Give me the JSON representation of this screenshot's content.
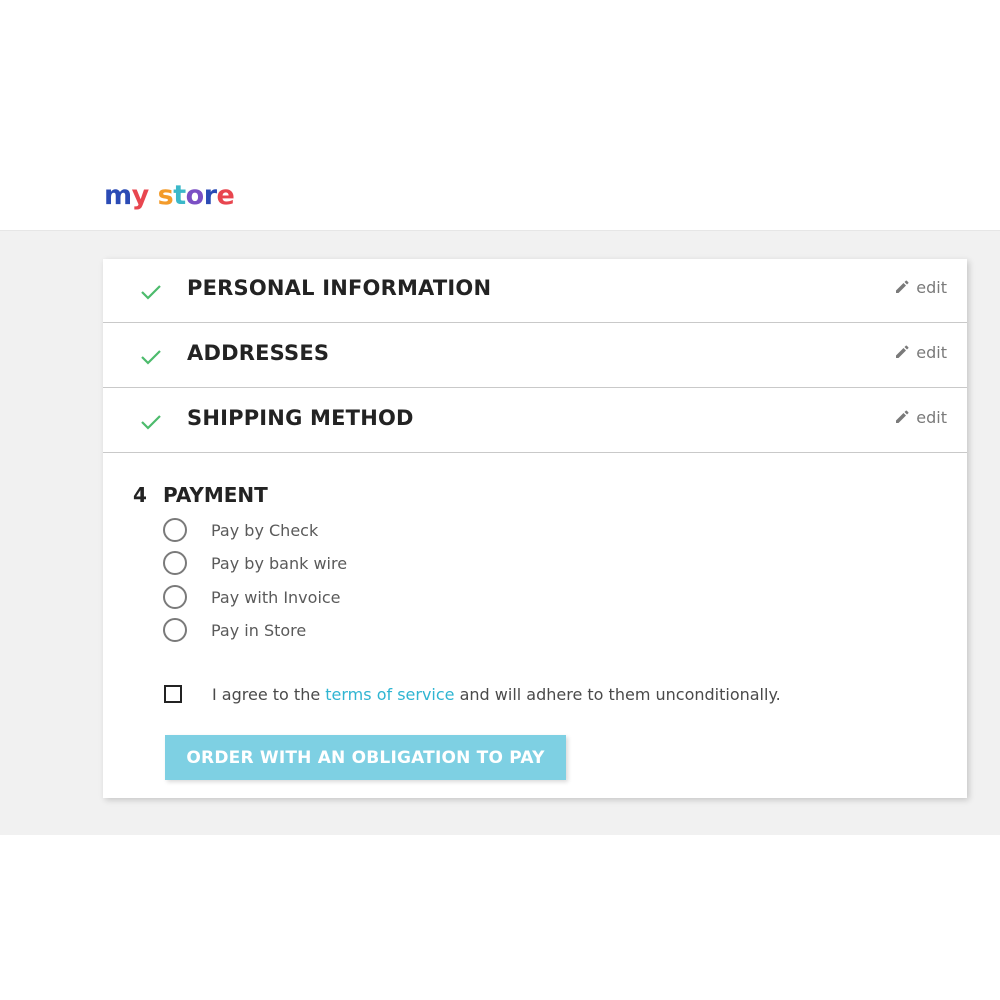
{
  "header": {
    "logo": {
      "word1": "my",
      "word2": "store",
      "colors": [
        "#2b4bb5",
        "#e8464f",
        "#f39b2a",
        "#3bb8c9",
        "#7b4fc4",
        "#e8464f"
      ]
    }
  },
  "checkout": {
    "completed_steps": [
      {
        "title": "PERSONAL INFORMATION",
        "edit_label": "edit",
        "icon": "check-icon"
      },
      {
        "title": "ADDRESSES",
        "edit_label": "edit",
        "icon": "check-icon"
      },
      {
        "title": "SHIPPING METHOD",
        "edit_label": "edit",
        "icon": "check-icon"
      }
    ],
    "payment": {
      "step_number": "4",
      "title": "PAYMENT",
      "options": [
        {
          "label": "Pay by Check",
          "selected": false
        },
        {
          "label": "Pay by bank wire",
          "selected": false
        },
        {
          "label": "Pay with Invoice",
          "selected": false
        },
        {
          "label": "Pay in Store",
          "selected": false
        }
      ],
      "terms": {
        "prefix": "I agree to the",
        "link_text": "terms of service",
        "suffix": "and will adhere to them unconditionally.",
        "checked": false
      },
      "order_button_label": "ORDER WITH AN OBLIGATION TO PAY"
    }
  },
  "colors": {
    "check_green": "#4cbb6c",
    "link_blue": "#2fb5d2",
    "button_bg": "#7ed0e3",
    "page_gray": "#f1f1f1"
  }
}
